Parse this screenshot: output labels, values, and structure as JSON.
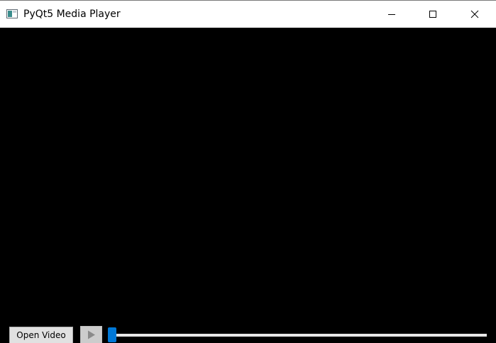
{
  "window": {
    "title": "PyQt5 Media Player"
  },
  "titlebar": {
    "icons": {
      "app": "app-window-icon",
      "minimize": "minimize-icon",
      "maximize": "maximize-icon",
      "close": "close-icon"
    }
  },
  "controls": {
    "open_label": "Open Video",
    "play_icon": "play-icon",
    "position_fraction": 0.0
  },
  "colors": {
    "titlebar_bg": "#ffffff",
    "video_bg": "#000000",
    "accent": "#0078d7",
    "button_bg": "#e1e1e1",
    "play_bg_disabled": "#cccccc"
  }
}
